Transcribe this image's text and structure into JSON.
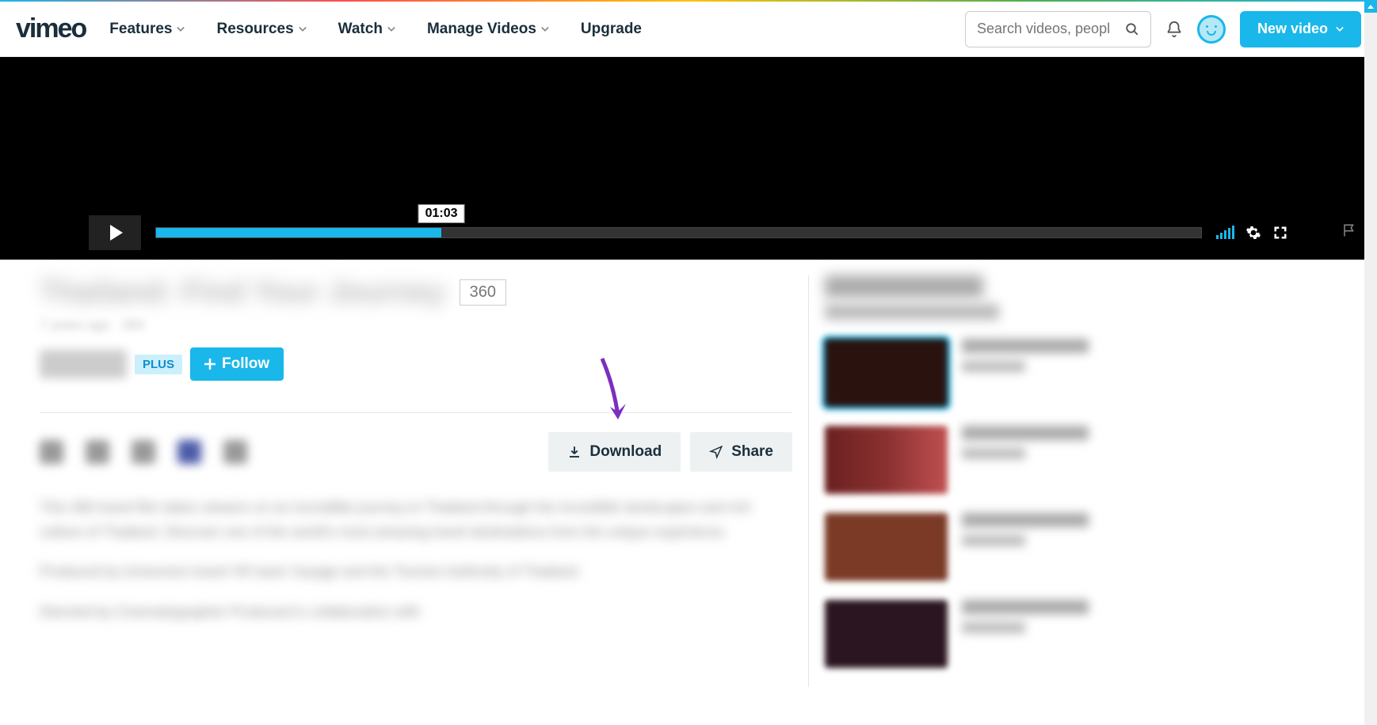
{
  "header": {
    "logo": "vimeo",
    "nav": {
      "features": "Features",
      "resources": "Resources",
      "watch": "Watch",
      "manage_videos": "Manage Videos",
      "upgrade": "Upgrade"
    },
    "search_placeholder": "Search videos, peopl",
    "new_video_label": "New video"
  },
  "player": {
    "time_tooltip": "01:03",
    "progress_percent": 27.3
  },
  "video": {
    "title_blurred": "Thailand: Find Your Journey",
    "badge_360": "360",
    "meta_blurred": "7 years ago · 360",
    "plus_badge": "PLUS",
    "follow_label": "Follow",
    "download_label": "Download",
    "share_label": "Share",
    "description_blurred_1": "This 360 travel film takes viewers on an incredible journey to Thailand through the incredible landscapes and rich culture of Thailand. Discover one of the world's most amazing travel destinations from the unique experience.",
    "description_blurred_2": "Produced by immersive travel VR team Voyage and the Tourism Authority of Thailand.",
    "description_blurred_3": "Directed by\nCinematographer\nProduced in collaboration with"
  },
  "sidebar": {
    "title_blurred": "More from Voyage",
    "sub_blurred": "Autoplay next video"
  }
}
